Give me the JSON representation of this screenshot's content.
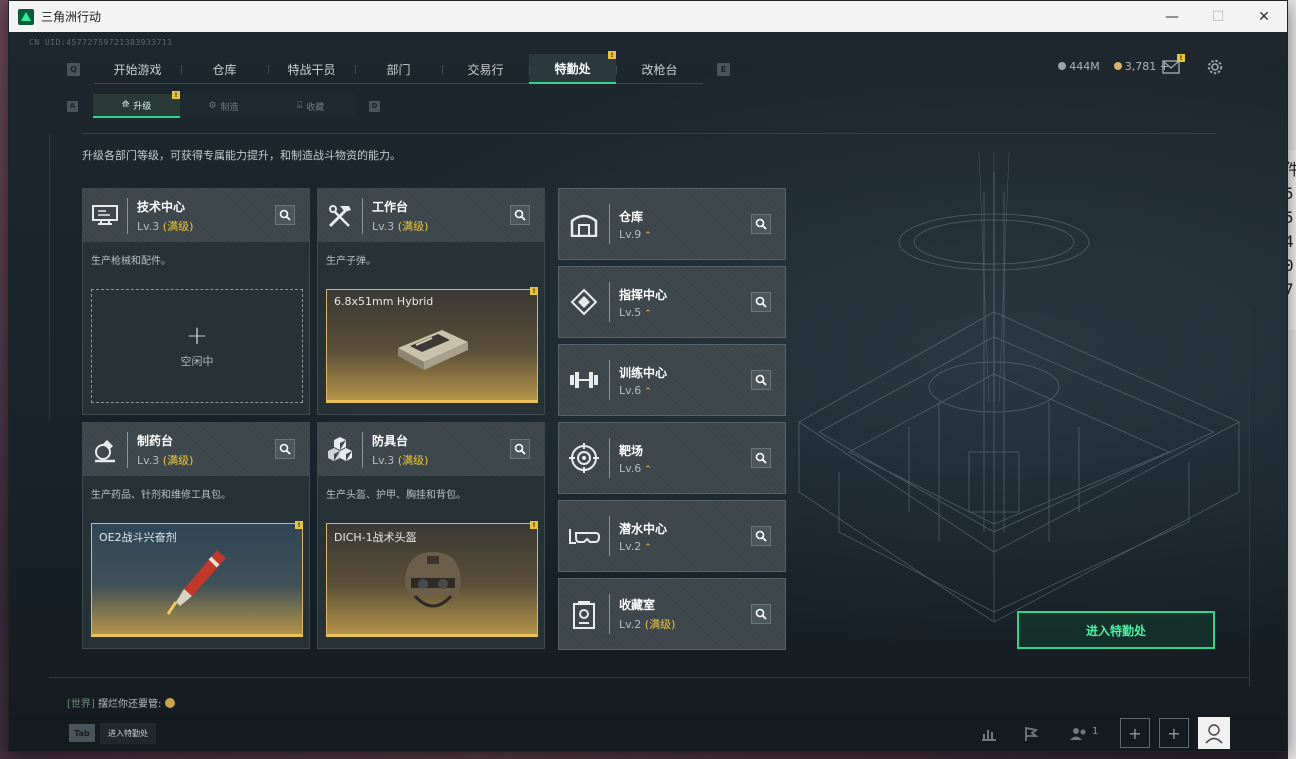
{
  "window": {
    "title": "三角洲行动",
    "controls": {
      "minimize": "—",
      "maximize": "☐",
      "close": "✕"
    }
  },
  "uid": "CN UID:4577275972138393371​1",
  "nav": {
    "left_key": "Q",
    "right_key": "E",
    "tabs": [
      {
        "label": "开始游戏"
      },
      {
        "label": "仓库"
      },
      {
        "label": "特战干员"
      },
      {
        "label": "部门"
      },
      {
        "label": "交易行"
      },
      {
        "label": "特勤处",
        "active": true,
        "badge": "!"
      },
      {
        "label": "改枪台"
      }
    ]
  },
  "currency": {
    "silver": "444M",
    "gold": "3,781 +"
  },
  "subnav": {
    "left_key": "A",
    "right_key": "D",
    "tabs": [
      {
        "label": "升级",
        "active": true,
        "badge": "!"
      },
      {
        "label": "制造"
      },
      {
        "label": "收藏"
      }
    ]
  },
  "description": "升级各部门等级，可获得专属能力提升，和制造战斗物资的能力。",
  "stations": [
    {
      "name": "技术中心",
      "lv": "Lv.3",
      "max": "(满级)",
      "desc": "生产枪械和配件。",
      "slot": {
        "type": "idle",
        "plus": "+",
        "label": "空闲中"
      }
    },
    {
      "name": "工作台",
      "lv": "Lv.3",
      "max": "(满级)",
      "desc": "生产子弹。",
      "slot": {
        "type": "item",
        "name": "6.8x51mm Hybrid",
        "badge": "!"
      }
    },
    {
      "name": "制药台",
      "lv": "Lv.3",
      "max": "(满级)",
      "desc": "生产药品、针剂和维修工具包。",
      "slot": {
        "type": "item",
        "name": "OE2战斗兴奋剂",
        "badge": "!"
      }
    },
    {
      "name": "防具台",
      "lv": "Lv.3",
      "max": "(满级)",
      "desc": "生产头盔、护甲、胸挂和背包。",
      "slot": {
        "type": "item",
        "name": "DICH-1战术头盔",
        "badge": "!"
      }
    }
  ],
  "buildings": [
    {
      "name": "仓库",
      "lv": "Lv.9",
      "arrow": "⌃"
    },
    {
      "name": "指挥中心",
      "lv": "Lv.5",
      "arrow": "⌃"
    },
    {
      "name": "训练中心",
      "lv": "Lv.6",
      "arrow": "⌃"
    },
    {
      "name": "靶场",
      "lv": "Lv.6",
      "arrow": "⌃"
    },
    {
      "name": "潜水中心",
      "lv": "Lv.2",
      "arrow": "⌃"
    },
    {
      "name": "收藏室",
      "lv": "Lv.2",
      "max": "(满级)"
    }
  ],
  "enter_button": "进入特勤处",
  "chat": {
    "channel": "[世界]",
    "message": "摆烂你还要管:"
  },
  "bottom": {
    "tab_key": "Tab",
    "tab_label": "进入特勤处",
    "friends_count": "1",
    "add_1": "+",
    "add_2": "+"
  },
  "desktop_peek": [
    "件",
    "5",
    "5",
    "4",
    "0",
    "7"
  ],
  "colors": {
    "accent": "#2fd58c",
    "gold": "#e9c43b"
  }
}
